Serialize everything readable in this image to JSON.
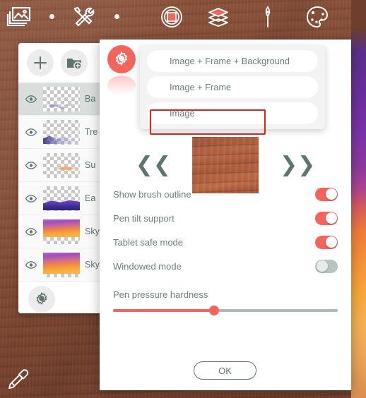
{
  "app": {
    "background_style": "wood-desk-with-sunset-canvas"
  },
  "toolbar": {
    "items": [
      {
        "name": "gallery-icon",
        "label": "Gallery"
      },
      {
        "name": "dot-separator-1",
        "label": ""
      },
      {
        "name": "tools-icon",
        "label": "Tools"
      },
      {
        "name": "dot-separator-2",
        "label": ""
      },
      {
        "name": "color-swatch-icon",
        "label": "Color"
      },
      {
        "name": "layers-icon",
        "label": "Layers"
      },
      {
        "name": "brush-icon",
        "label": "Brush"
      },
      {
        "name": "palette-icon",
        "label": "Palette"
      }
    ]
  },
  "layers_panel": {
    "add_layer_label": "+",
    "add_group_label": "Add group",
    "settings_label": "Layer settings",
    "layers": [
      {
        "name": "Ba",
        "visible": true,
        "selected": true
      },
      {
        "name": "Tre",
        "visible": true,
        "selected": false
      },
      {
        "name": "Su",
        "visible": true,
        "selected": false
      },
      {
        "name": "Ea",
        "visible": true,
        "selected": false
      },
      {
        "name": "Sky",
        "visible": true,
        "selected": false
      },
      {
        "name": "Sky",
        "visible": true,
        "selected": false
      }
    ]
  },
  "dialog": {
    "gear_button_label": "Settings",
    "dropdown": {
      "options": [
        "Image + Frame + Background",
        "Image + Frame",
        "Image"
      ],
      "selected": "Image + Frame",
      "highlight_color": "#e8201a"
    },
    "carousel": {
      "prev_label": "❮❮",
      "next_label": "❯❯",
      "swatch_name": "wood-texture"
    },
    "settings": [
      {
        "label": "Show brush outline",
        "state": "on"
      },
      {
        "label": "Pen tilt support",
        "state": "on"
      },
      {
        "label": "Tablet safe mode",
        "state": "on"
      },
      {
        "label": "Windowed mode",
        "state": "off"
      }
    ],
    "slider": {
      "label": "Pen pressure hardness",
      "percent": 45
    },
    "ok_label": "OK"
  },
  "colors": {
    "accent_red": "#f4635c",
    "text_muted": "#6b7f7c",
    "panel_bg": "#ffffff",
    "wood": "#8b5138"
  }
}
